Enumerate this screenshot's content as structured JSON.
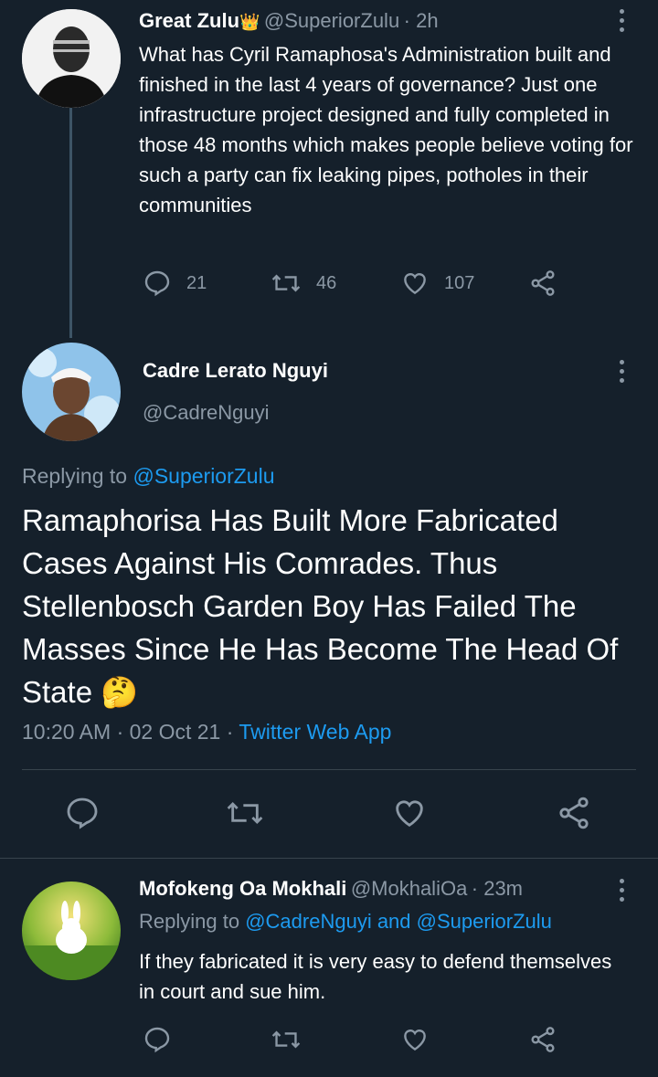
{
  "tweet1": {
    "name": "Great Zulu",
    "badge": "👑",
    "handle": "@SuperiorZulu",
    "time": "· 2h",
    "text": "What has Cyril Ramaphosa's Administration built and finished in the last 4 years of governance? Just one infrastructure project designed and fully completed in those 48 months which makes people believe voting for such a party can fix leaking pipes, potholes in their communities",
    "replies": "21",
    "retweets": "46",
    "likes": "107"
  },
  "main_tweet": {
    "name": "Cadre Lerato Nguyi",
    "handle": "@CadreNguyi",
    "replying_prefix": "Replying to",
    "replying_to": "@SuperiorZulu",
    "text": "Ramaphorisa Has Built More Fabricated Cases Against His Comrades. Thus Stellenbosch Garden Boy Has Failed The Masses Since He Has Become The Head Of State 🤔",
    "timestamp": "10:20 AM · 02 Oct 21 ·",
    "source": "Twitter Web App"
  },
  "reply1": {
    "name": "Mofokeng Oa Mokhali",
    "handle": "@MokhaliOa",
    "time": "· 23m",
    "replying_prefix": "Replying to",
    "replying_to": "@CadreNguyi and @SuperiorZulu",
    "text": "If they fabricated it is very easy to defend themselves in court and sue him."
  },
  "colors": {
    "background": "#15202b",
    "muted": "#8b98a5",
    "accent": "#1d9bf0",
    "divider": "#38444d"
  },
  "icons": [
    "reply-icon",
    "retweet-icon",
    "like-icon",
    "share-icon",
    "more-icon"
  ]
}
